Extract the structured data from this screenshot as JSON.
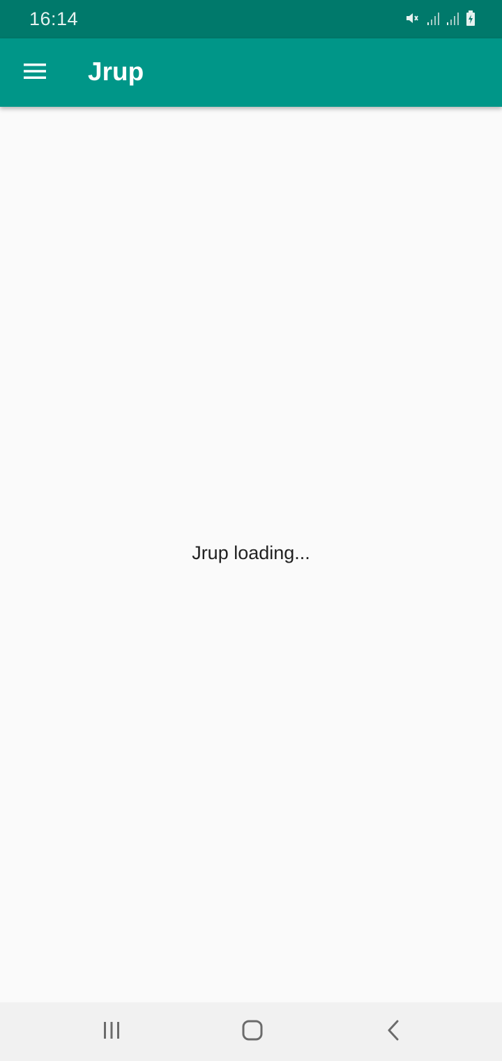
{
  "status_bar": {
    "time": "16:14",
    "icons": [
      "mute-icon",
      "signal-icon",
      "signal-icon",
      "battery-charging-icon"
    ]
  },
  "app_bar": {
    "title": "Jrup",
    "menu_icon": "menu-icon",
    "color": "#009688"
  },
  "content": {
    "loading_text": "Jrup loading..."
  },
  "nav_bar": {
    "buttons": [
      "recent-apps-icon",
      "home-icon",
      "back-icon"
    ]
  },
  "colors": {
    "status_bar": "#00796b",
    "app_bar": "#009688",
    "background": "#fafafa",
    "nav_bar": "#f1f1f1"
  }
}
